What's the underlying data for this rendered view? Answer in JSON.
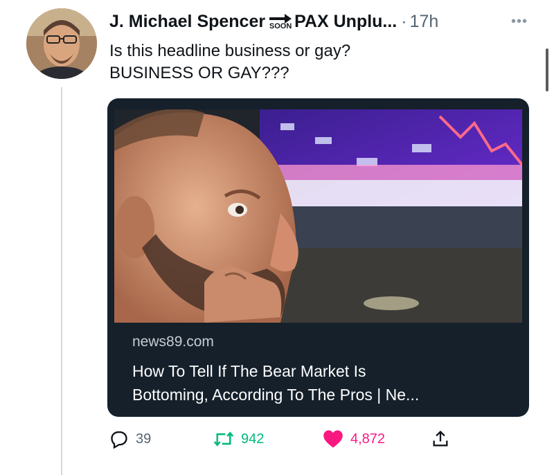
{
  "tweet": {
    "author_name": "J. Michael Spencer",
    "soon_label": "SOON",
    "handle": "PAX Unplu...",
    "separator": "·",
    "time": "17h",
    "text_line1": "Is this headline business or gay?",
    "text_line2": "BUSINESS OR GAY???"
  },
  "card": {
    "domain": "news89.com",
    "title_line1": "How To Tell If The Bear Market Is",
    "title_line2": "Bottoming, According To The Pros | Ne..."
  },
  "actions": {
    "replies": "39",
    "retweets": "942",
    "likes": "4,872"
  },
  "colors": {
    "card_bg": "#15202b",
    "retweet": "#00ba7c",
    "like": "#f91880",
    "muted": "#536471"
  },
  "icons": [
    "more-icon",
    "soon-arrow-icon",
    "reply-icon",
    "retweet-icon",
    "heart-icon",
    "share-icon"
  ]
}
